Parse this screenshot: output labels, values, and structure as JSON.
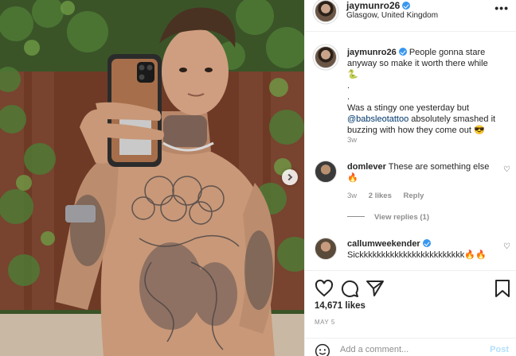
{
  "post": {
    "username": "jaymunro26",
    "location": "Glasgow, United Kingdom",
    "more_label": "•••",
    "caption_line1": "People gonna stare anyway so make it worth there while 🐍",
    "caption_dot1": ".",
    "caption_dot2": ".",
    "caption_line2_pre": "Was a stingy one yesterday but",
    "caption_mention": "@babsleotattoo",
    "caption_line2_post": "absolutely smashed it buzzing with how they come out 😎",
    "caption_time": "3w",
    "likes": "14,671 likes",
    "date": "MAY 5"
  },
  "comments": [
    {
      "username": "domlever",
      "text": "These are something else 🔥",
      "time": "3w",
      "likes": "2 likes",
      "reply_label": "Reply",
      "view_replies": "View replies (1)"
    },
    {
      "username": "callumweekender",
      "text": "Sickkkkkkkkkkkkkkkkkkkkkkkk🔥🔥"
    }
  ],
  "comment_box": {
    "placeholder": "Add a comment...",
    "post_label": "Post"
  },
  "colors": {
    "verified": "#3897f0",
    "mention": "#00376b",
    "post_button": "#b2dffc"
  },
  "icons": [
    "heart-icon",
    "comment-icon",
    "share-icon",
    "bookmark-icon",
    "emoji-icon",
    "verified-icon",
    "next-arrow-icon"
  ]
}
